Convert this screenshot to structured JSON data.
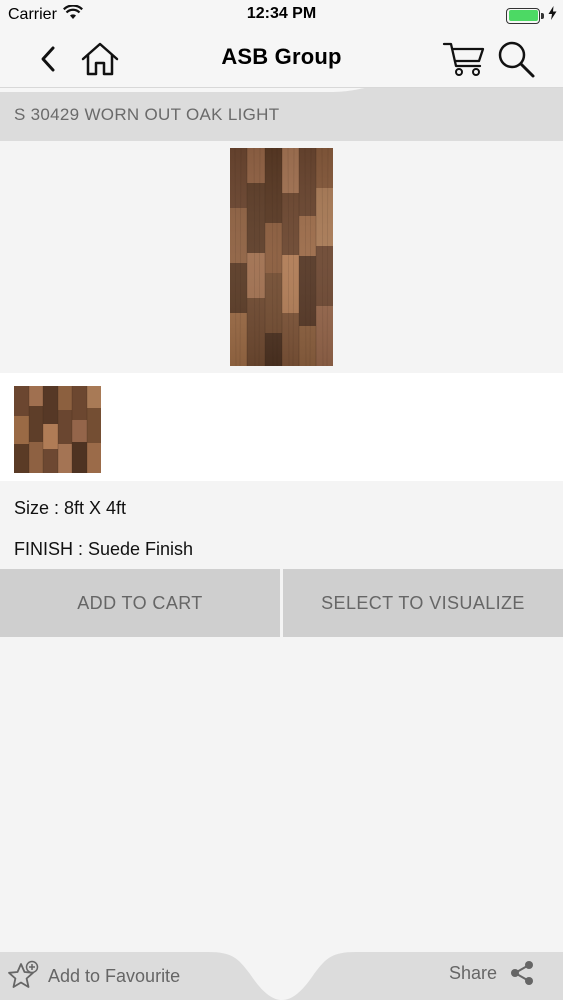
{
  "status_bar": {
    "carrier": "Carrier",
    "time": "12:34 PM",
    "battery_level": 1.0
  },
  "nav": {
    "title": "ASB Group",
    "icons": [
      "chevron-left-icon",
      "home-icon",
      "cart-icon",
      "search-icon"
    ]
  },
  "product": {
    "title": "S 30429 WORN OUT OAK LIGHT",
    "size": "Size : 8ft X 4ft",
    "finish": "FINISH : Suede Finish"
  },
  "actions": {
    "add_to_cart": "ADD TO CART",
    "select_to_visualize": "SELECT TO VISUALIZE"
  },
  "bottom": {
    "favourite": "Add to Favourite",
    "share": "Share"
  },
  "colors": {
    "bar_background": "#f6f6f6",
    "page_background": "#f4f4f4",
    "button_background": "#cfcfcf",
    "button_text": "#666666",
    "battery": "#4cd964",
    "wood_dark": "#5a3b26",
    "wood_light": "#9a6a45"
  }
}
